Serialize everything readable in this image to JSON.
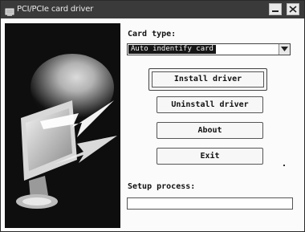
{
  "window": {
    "title": "PCI/PCIe card driver"
  },
  "card_type": {
    "label": "Card type:",
    "selected": "Auto indentify card"
  },
  "buttons": {
    "install": "Install driver",
    "uninstall": "Uninstall driver",
    "about": "About",
    "exit": "Exit"
  },
  "setup": {
    "label": "Setup process:",
    "progress": 0
  },
  "icons": [
    "app-icon",
    "minimize-icon",
    "close-icon",
    "dropdown-arrow-icon"
  ]
}
